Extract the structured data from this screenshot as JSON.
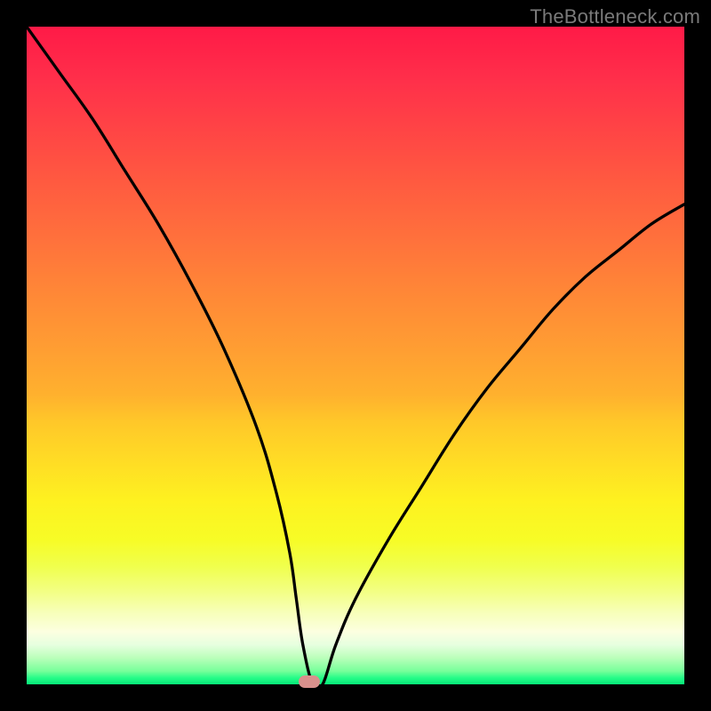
{
  "watermark": {
    "text": "TheBottleneck.com"
  },
  "chart_data": {
    "type": "line",
    "title": "",
    "xlabel": "",
    "ylabel": "",
    "xlim": [
      0,
      100
    ],
    "ylim": [
      0,
      100
    ],
    "grid": false,
    "legend": null,
    "series": [
      {
        "name": "bottleneck-curve",
        "x": [
          0,
          5,
          10,
          15,
          20,
          25,
          30,
          35,
          38,
          40,
          41,
          42,
          43.5,
          45,
          47,
          50,
          55,
          60,
          65,
          70,
          75,
          80,
          85,
          90,
          95,
          100
        ],
        "y": [
          100,
          93,
          86,
          78,
          70,
          61,
          51,
          39,
          29,
          20,
          13,
          6,
          0,
          0,
          6,
          13,
          22,
          30,
          38,
          45,
          51,
          57,
          62,
          66,
          70,
          73
        ]
      }
    ],
    "annotations": [
      {
        "name": "optimal-marker",
        "x": 43,
        "y": 0
      }
    ],
    "background_gradient": {
      "top_color": "#ff1a47",
      "mid_color": "#ffdc25",
      "bottom_color": "#06e878"
    }
  }
}
